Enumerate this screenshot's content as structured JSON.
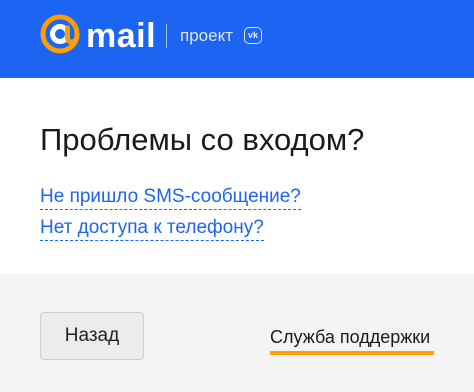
{
  "header": {
    "logo_text": "mail",
    "project_text": "проект",
    "vk_badge_text": "vk",
    "colors": {
      "background": "#1c64f2",
      "logo_at": "#ff9e00"
    },
    "icons": {
      "logo": "mail-at-logo-icon",
      "vk": "vk-logo-icon"
    }
  },
  "main": {
    "title": "Проблемы со входом?",
    "links": [
      {
        "label": "Не пришло SMS-сообщение?"
      },
      {
        "label": "Нет доступа к телефону?"
      }
    ],
    "link_color": "#1c64f2"
  },
  "footer": {
    "back_label": "Назад",
    "support_label": "Служба поддержки",
    "accent_color": "#ff9e00"
  }
}
